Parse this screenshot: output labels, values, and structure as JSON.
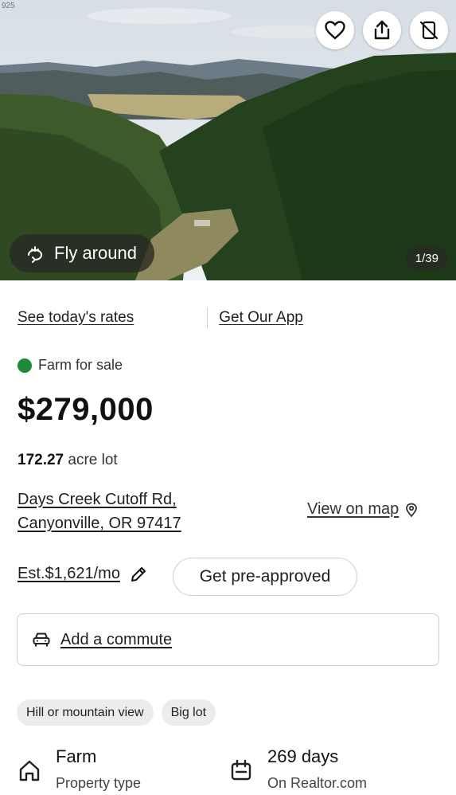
{
  "hero": {
    "corner_text": "925",
    "fly_around_label": "Fly around",
    "photo_counter": "1/39",
    "icons": [
      "heart-icon",
      "share-icon",
      "no-phone-icon",
      "fly-around-icon"
    ]
  },
  "links": {
    "rates": "See today's rates",
    "app": "Get Our App"
  },
  "listing": {
    "status": "Farm for sale",
    "status_color": "#1e8a3a",
    "price": "$279,000",
    "lot_size": "172.27",
    "lot_unit": "acre lot",
    "address_line1": "Days Creek Cutoff Rd,",
    "address_line2": "Canyonville, OR 97417",
    "view_on_map": "View on map"
  },
  "payment": {
    "estimate": "Est.$1,621/mo",
    "preapproved_label": "Get pre-approved"
  },
  "commute": {
    "label": "Add a commute"
  },
  "tags": [
    "Hill or mountain view",
    "Big lot"
  ],
  "facts": [
    {
      "value": "Farm",
      "label": "Property type",
      "icon": "house-icon"
    },
    {
      "value": "269 days",
      "label": "On Realtor.com",
      "icon": "calendar-icon"
    }
  ]
}
